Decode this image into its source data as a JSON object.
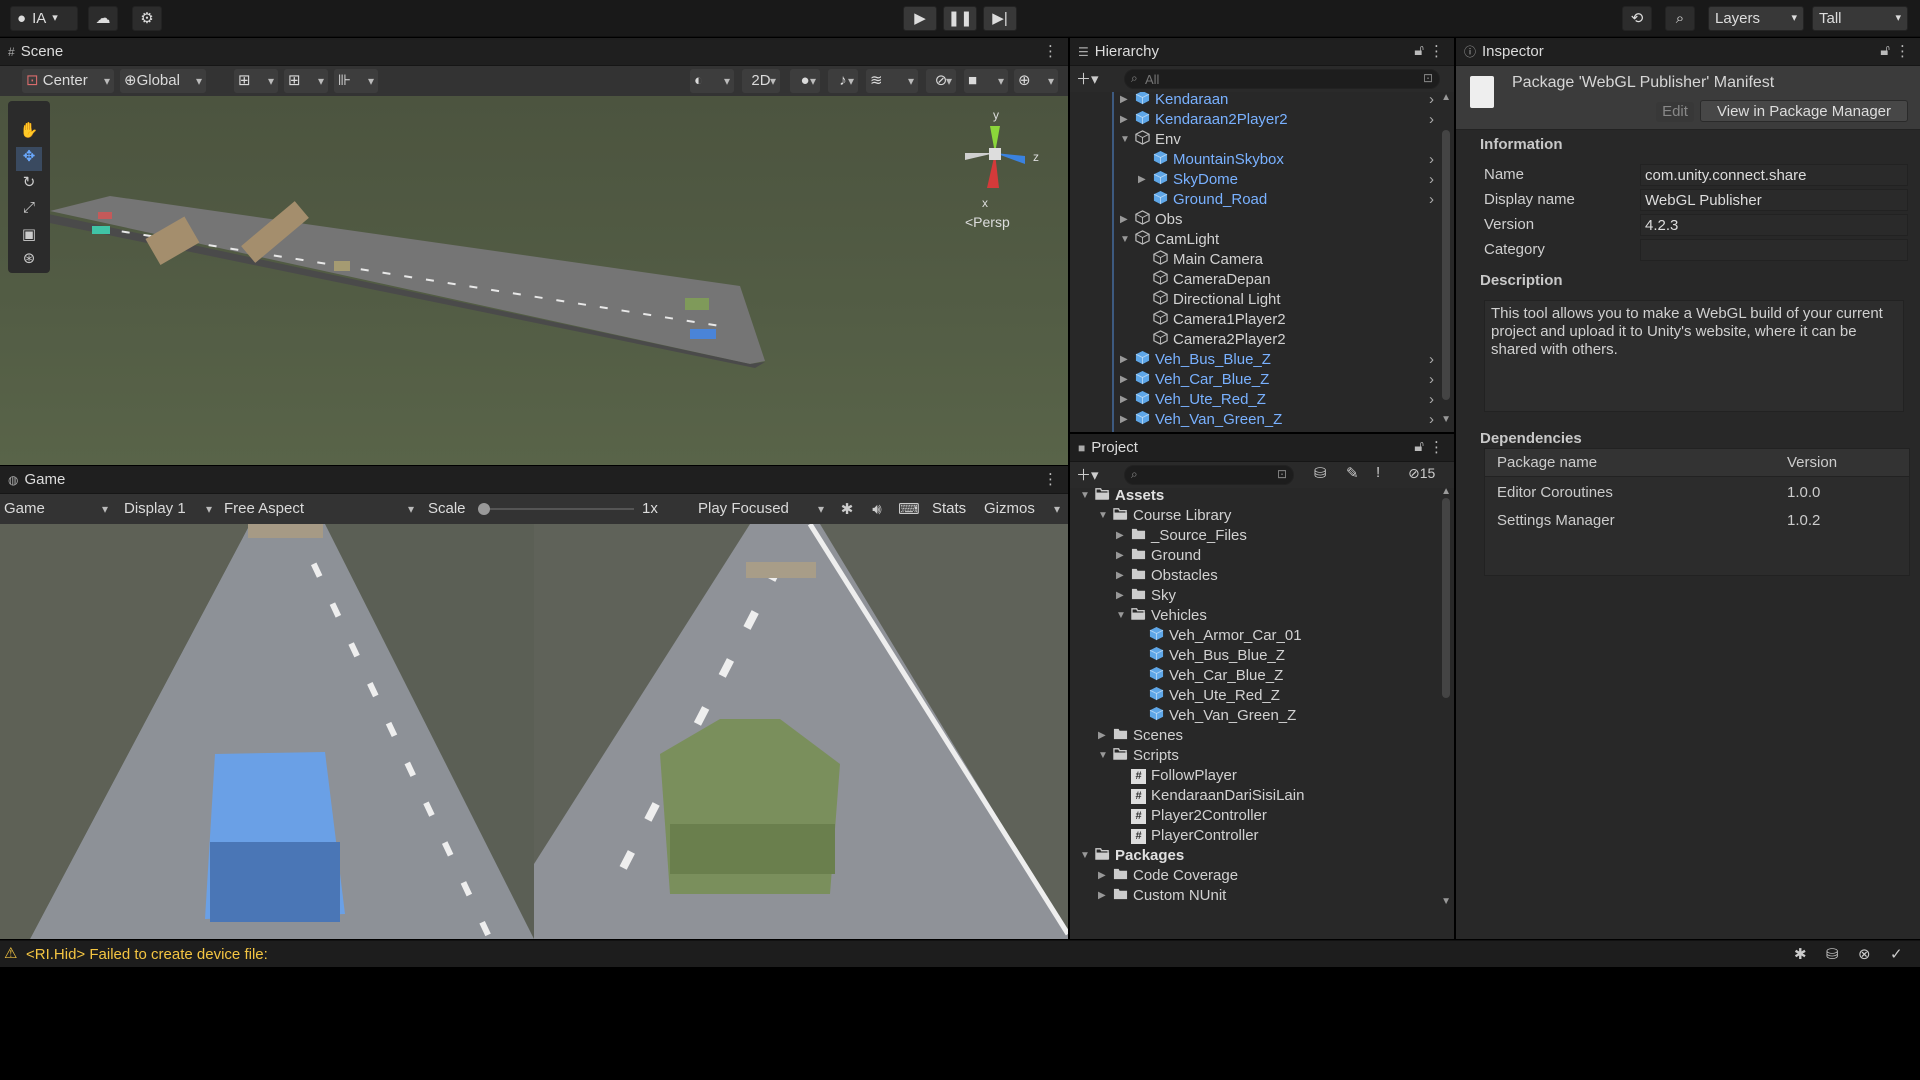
{
  "toolbar": {
    "account": "IA",
    "layers": "Layers",
    "layout": "Tall"
  },
  "scene": {
    "tab": "Scene",
    "pivot": "Center",
    "space": "Global",
    "mode_2d": "2D",
    "persp": "<Persp",
    "gizmo_y": "y",
    "gizmo_z": "z",
    "gizmo_x": "x"
  },
  "game": {
    "tab": "Game",
    "view": "Game",
    "display": "Display 1",
    "aspect": "Free Aspect",
    "scale_label": "Scale",
    "scale_value": "1x",
    "scale_level": 0.0,
    "play_mode": "Play Focused",
    "stats": "Stats",
    "gizmos": "Gizmos"
  },
  "hierarchy": {
    "tab": "Hierarchy",
    "search_placeholder": "All",
    "items": [
      {
        "label": "Kendaraan",
        "depth": 1,
        "type": "prefab",
        "expand": "collapsed",
        "more": true
      },
      {
        "label": "Kendaraan2Player2",
        "depth": 1,
        "type": "prefab",
        "expand": "collapsed",
        "more": true
      },
      {
        "label": "Env",
        "depth": 1,
        "type": "object",
        "expand": "expanded",
        "more": false
      },
      {
        "label": "MountainSkybox",
        "depth": 2,
        "type": "prefab",
        "expand": "none",
        "more": true
      },
      {
        "label": "SkyDome",
        "depth": 2,
        "type": "prefab",
        "expand": "collapsed",
        "more": true
      },
      {
        "label": "Ground_Road",
        "depth": 2,
        "type": "prefab",
        "expand": "none",
        "more": true
      },
      {
        "label": "Obs",
        "depth": 1,
        "type": "object",
        "expand": "collapsed",
        "more": false
      },
      {
        "label": "CamLight",
        "depth": 1,
        "type": "object",
        "expand": "expanded",
        "more": false
      },
      {
        "label": "Main Camera",
        "depth": 2,
        "type": "object",
        "expand": "none",
        "more": false
      },
      {
        "label": "CameraDepan",
        "depth": 2,
        "type": "object",
        "expand": "none",
        "more": false
      },
      {
        "label": "Directional Light",
        "depth": 2,
        "type": "object",
        "expand": "none",
        "more": false
      },
      {
        "label": "Camera1Player2",
        "depth": 2,
        "type": "object",
        "expand": "none",
        "more": false
      },
      {
        "label": "Camera2Player2",
        "depth": 2,
        "type": "object",
        "expand": "none",
        "more": false
      },
      {
        "label": "Veh_Bus_Blue_Z",
        "depth": 1,
        "type": "prefab",
        "expand": "collapsed",
        "more": true
      },
      {
        "label": "Veh_Car_Blue_Z",
        "depth": 1,
        "type": "prefab",
        "expand": "collapsed",
        "more": true
      },
      {
        "label": "Veh_Ute_Red_Z",
        "depth": 1,
        "type": "prefab",
        "expand": "collapsed",
        "more": true
      },
      {
        "label": "Veh_Van_Green_Z",
        "depth": 1,
        "type": "prefab",
        "expand": "collapsed",
        "more": true
      }
    ]
  },
  "project": {
    "tab": "Project",
    "hidden_count": "15",
    "items": [
      {
        "label": "Assets",
        "depth": 0,
        "type": "folder-open",
        "expand": "expanded",
        "bold": true
      },
      {
        "label": "Course Library",
        "depth": 1,
        "type": "folder-open",
        "expand": "expanded",
        "bold": false
      },
      {
        "label": "_Source_Files",
        "depth": 2,
        "type": "folder",
        "expand": "collapsed",
        "bold": false
      },
      {
        "label": "Ground",
        "depth": 2,
        "type": "folder",
        "expand": "collapsed",
        "bold": false
      },
      {
        "label": "Obstacles",
        "depth": 2,
        "type": "folder",
        "expand": "collapsed",
        "bold": false
      },
      {
        "label": "Sky",
        "depth": 2,
        "type": "folder",
        "expand": "collapsed",
        "bold": false
      },
      {
        "label": "Vehicles",
        "depth": 2,
        "type": "folder-open",
        "expand": "expanded",
        "bold": false
      },
      {
        "label": "Veh_Armor_Car_01",
        "depth": 3,
        "type": "prefab",
        "expand": "none",
        "bold": false
      },
      {
        "label": "Veh_Bus_Blue_Z",
        "depth": 3,
        "type": "prefab",
        "expand": "none",
        "bold": false
      },
      {
        "label": "Veh_Car_Blue_Z",
        "depth": 3,
        "type": "prefab",
        "expand": "none",
        "bold": false
      },
      {
        "label": "Veh_Ute_Red_Z",
        "depth": 3,
        "type": "prefab",
        "expand": "none",
        "bold": false
      },
      {
        "label": "Veh_Van_Green_Z",
        "depth": 3,
        "type": "prefab",
        "expand": "none",
        "bold": false
      },
      {
        "label": "Scenes",
        "depth": 1,
        "type": "folder",
        "expand": "collapsed",
        "bold": false
      },
      {
        "label": "Scripts",
        "depth": 1,
        "type": "folder-open",
        "expand": "expanded",
        "bold": false
      },
      {
        "label": "FollowPlayer",
        "depth": 2,
        "type": "script",
        "expand": "none",
        "bold": false
      },
      {
        "label": "KendaraanDariSisiLain",
        "depth": 2,
        "type": "script",
        "expand": "none",
        "bold": false
      },
      {
        "label": "Player2Controller",
        "depth": 2,
        "type": "script",
        "expand": "none",
        "bold": false
      },
      {
        "label": "PlayerController",
        "depth": 2,
        "type": "script",
        "expand": "none",
        "bold": false
      },
      {
        "label": "Packages",
        "depth": 0,
        "type": "folder-open",
        "expand": "expanded",
        "bold": true
      },
      {
        "label": "Code Coverage",
        "depth": 1,
        "type": "folder",
        "expand": "collapsed",
        "bold": false
      },
      {
        "label": "Custom NUnit",
        "depth": 1,
        "type": "folder",
        "expand": "collapsed",
        "bold": false
      }
    ]
  },
  "inspector": {
    "tab": "Inspector",
    "title": "Package 'WebGL Publisher' Manifest",
    "edit": "Edit",
    "view_pm": "View in Package Manager",
    "information": "Information",
    "fields": [
      {
        "label": "Name",
        "value": "com.unity.connect.share"
      },
      {
        "label": "Display name",
        "value": "WebGL Publisher"
      },
      {
        "label": "Version",
        "value": "4.2.3"
      },
      {
        "label": "Category",
        "value": ""
      }
    ],
    "description_head": "Description",
    "description": "This tool allows you to make a WebGL build of your current project and upload it to Unity's website, where it can be shared with others.",
    "dependencies_head": "Dependencies",
    "dep_col_name": "Package name",
    "dep_col_version": "Version",
    "dependencies": [
      {
        "name": "Editor Coroutines",
        "version": "1.0.0"
      },
      {
        "name": "Settings Manager",
        "version": "1.0.2"
      }
    ]
  },
  "status": {
    "message": "<RI.Hid> Failed to create device file:",
    "warn_color": "#f4c542"
  }
}
